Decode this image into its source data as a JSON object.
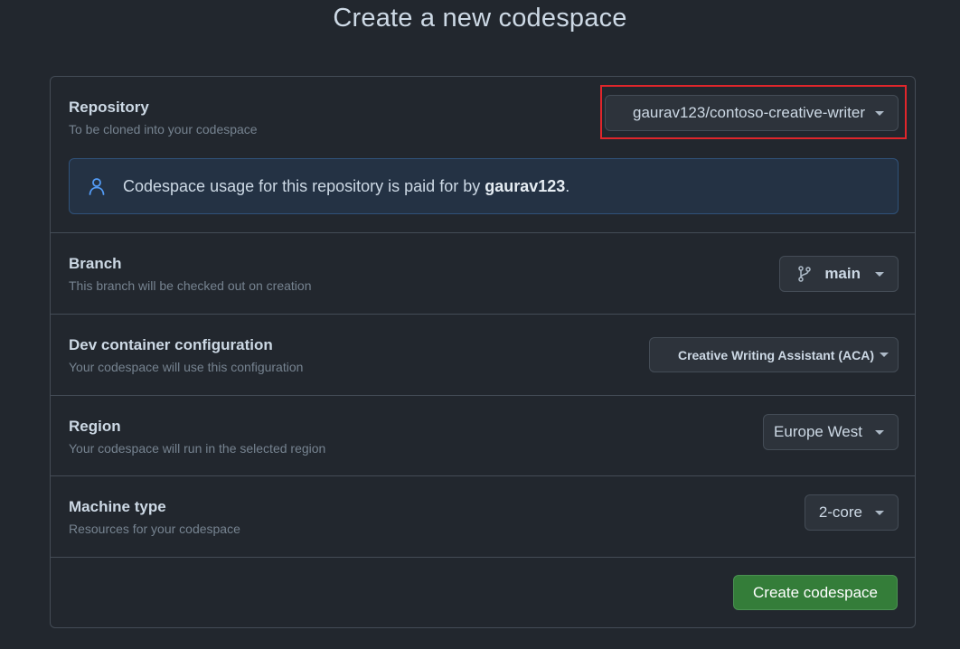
{
  "page": {
    "title": "Create a new codespace"
  },
  "repository": {
    "label": "Repository",
    "description": "To be cloned into your codespace",
    "selected": "gaurav123/contoso-creative-writer",
    "notice_prefix": "Codespace usage for this repository is paid for by",
    "notice_owner": "gaurav123",
    "notice_suffix": "."
  },
  "branch": {
    "label": "Branch",
    "description": "This branch will be checked out on creation",
    "selected": "main"
  },
  "devcontainer": {
    "label": "Dev container configuration",
    "description": "Your codespace will use this configuration",
    "selected": "Creative Writing Assistant (ACA)"
  },
  "region": {
    "label": "Region",
    "description": "Your codespace will run in the selected region",
    "selected": "Europe West"
  },
  "machine": {
    "label": "Machine type",
    "description": "Resources for your codespace",
    "selected": "2-core"
  },
  "actions": {
    "create_label": "Create codespace"
  },
  "colors": {
    "background": "#22272e",
    "primary_button": "#347d39",
    "highlight": "#e0262b",
    "notice_bg": "#243244"
  },
  "icons": {
    "notice": "person-icon",
    "branch": "git-branch-icon",
    "dropdown": "caret-down-icon"
  }
}
